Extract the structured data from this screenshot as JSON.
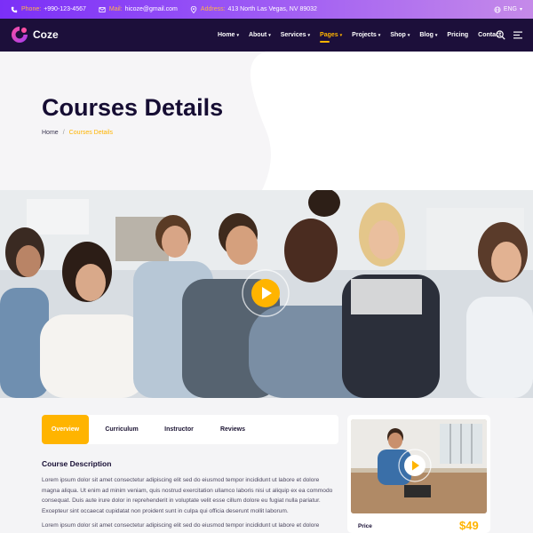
{
  "topbar": {
    "phone_label": "Phone:",
    "phone": "+990-123-4567",
    "mail_label": "Mail:",
    "mail": "hicoze@gmail.com",
    "address_label": "Address:",
    "address": "413 North Las Vegas, NV 89032",
    "language": "ENG",
    "phone_icon": "phone-icon",
    "mail_icon": "mail-icon",
    "address_icon": "map-pin-icon",
    "language_icon": "globe-icon"
  },
  "brand": {
    "name": "Coze",
    "logo_icon": "coze-logo-icon"
  },
  "nav": {
    "items": [
      {
        "label": "Home"
      },
      {
        "label": "About"
      },
      {
        "label": "Services"
      },
      {
        "label": "Pages"
      },
      {
        "label": "Projects"
      },
      {
        "label": "Shop"
      },
      {
        "label": "Blog"
      },
      {
        "label": "Pricing"
      },
      {
        "label": "Contact"
      }
    ],
    "active": "Pages",
    "search_icon": "search-icon",
    "menu_icon": "hamburger-menu-icon"
  },
  "hero": {
    "title": "Courses Details",
    "breadcrumb": {
      "home": "Home",
      "separator": "/",
      "current": "Courses Details"
    }
  },
  "banner": {
    "play_icon": "play-icon"
  },
  "tabs": [
    {
      "label": "Overview"
    },
    {
      "label": "Curriculum"
    },
    {
      "label": "Instructor"
    },
    {
      "label": "Reviews"
    }
  ],
  "course": {
    "description_title": "Course Description",
    "paragraph1": "Lorem ipsum dolor sit amet consectetur adipiscing elit sed do eiusmod tempor incididunt ut labore et dolore magna aliqua. Ut enim ad minim veniam, quis nostrud exercitation ullamco laboris nisi ut aliquip ex ea commodo consequat. Duis aute irure dolor in reprehenderit in voluptate velit esse cillum dolore eu fugiat nulla pariatur. Excepteur sint occaecat cupidatat non proident sunt in culpa qui officia deserunt mollit laborum.",
    "paragraph2": "Lorem ipsum dolor sit amet consectetur adipiscing elit sed do eiusmod tempor incididunt ut labore et dolore"
  },
  "sidebar": {
    "price_label": "Price",
    "price": "$49"
  },
  "colors": {
    "accent": "#ffb400",
    "nav_bg": "#1c0f3a",
    "topbar_gradient_start": "#7b2ff7",
    "topbar_gradient_end": "#c58ae9"
  }
}
